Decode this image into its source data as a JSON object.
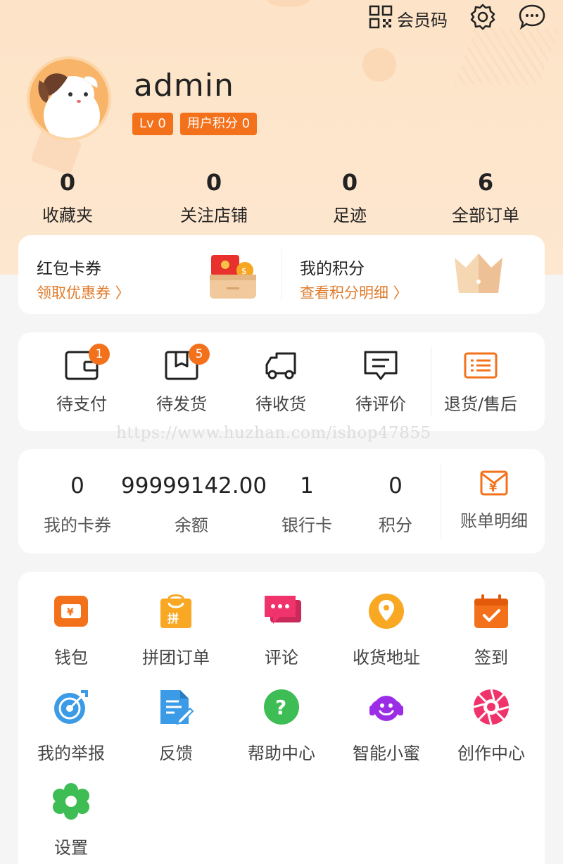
{
  "header": {
    "member_code_label": "会员码",
    "settings_icon": "gear-icon",
    "message_icon": "chat-bubble-icon"
  },
  "profile": {
    "username": "admin",
    "level_badge": "Lv 0",
    "points_badge": "用户积分 0"
  },
  "stats": [
    {
      "value": "0",
      "label": "收藏夹"
    },
    {
      "value": "0",
      "label": "关注店铺"
    },
    {
      "value": "0",
      "label": "足迹"
    },
    {
      "value": "6",
      "label": "全部订单"
    }
  ],
  "promo": {
    "coupons": {
      "title": "红包卡券",
      "link": "领取优惠券 〉"
    },
    "points": {
      "title": "我的积分",
      "link": "查看积分明细 〉"
    }
  },
  "orders": [
    {
      "label": "待支付",
      "badge": "1",
      "icon": "wallet-icon"
    },
    {
      "label": "待发货",
      "badge": "5",
      "icon": "package-icon"
    },
    {
      "label": "待收货",
      "badge": "",
      "icon": "truck-icon"
    },
    {
      "label": "待评价",
      "badge": "",
      "icon": "comment-icon"
    },
    {
      "label": "退货/售后",
      "badge": "",
      "icon": "list-icon"
    }
  ],
  "watermark": "https://www.huzhan.com/ishop47855",
  "wallet": [
    {
      "value": "0",
      "label": "我的卡券"
    },
    {
      "value": "99999142.00",
      "label": "余额"
    },
    {
      "value": "1",
      "label": "银行卡"
    },
    {
      "value": "0",
      "label": "积分"
    }
  ],
  "bill": {
    "label": "账单明细"
  },
  "services": [
    {
      "label": "钱包",
      "icon": "wallet-ticket-icon",
      "color": "#f4711b"
    },
    {
      "label": "拼团订单",
      "icon": "group-buy-bag-icon",
      "color": "#f8a823"
    },
    {
      "label": "评论",
      "icon": "comments-icon",
      "color": "#f0336b"
    },
    {
      "label": "收货地址",
      "icon": "location-pin-icon",
      "color": "#f8a823"
    },
    {
      "label": "签到",
      "icon": "calendar-check-icon",
      "color": "#f4711b"
    },
    {
      "label": "我的举报",
      "icon": "target-icon",
      "color": "#3b9be6"
    },
    {
      "label": "反馈",
      "icon": "document-edit-icon",
      "color": "#3b9be6"
    },
    {
      "label": "帮助中心",
      "icon": "question-icon",
      "color": "#3ebd54"
    },
    {
      "label": "智能小蜜",
      "icon": "assistant-headset-icon",
      "color": "#9b2de6"
    },
    {
      "label": "创作中心",
      "icon": "aperture-icon",
      "color": "#f0336b"
    },
    {
      "label": "设置",
      "icon": "settings-flower-icon",
      "color": "#3ebd54"
    }
  ]
}
